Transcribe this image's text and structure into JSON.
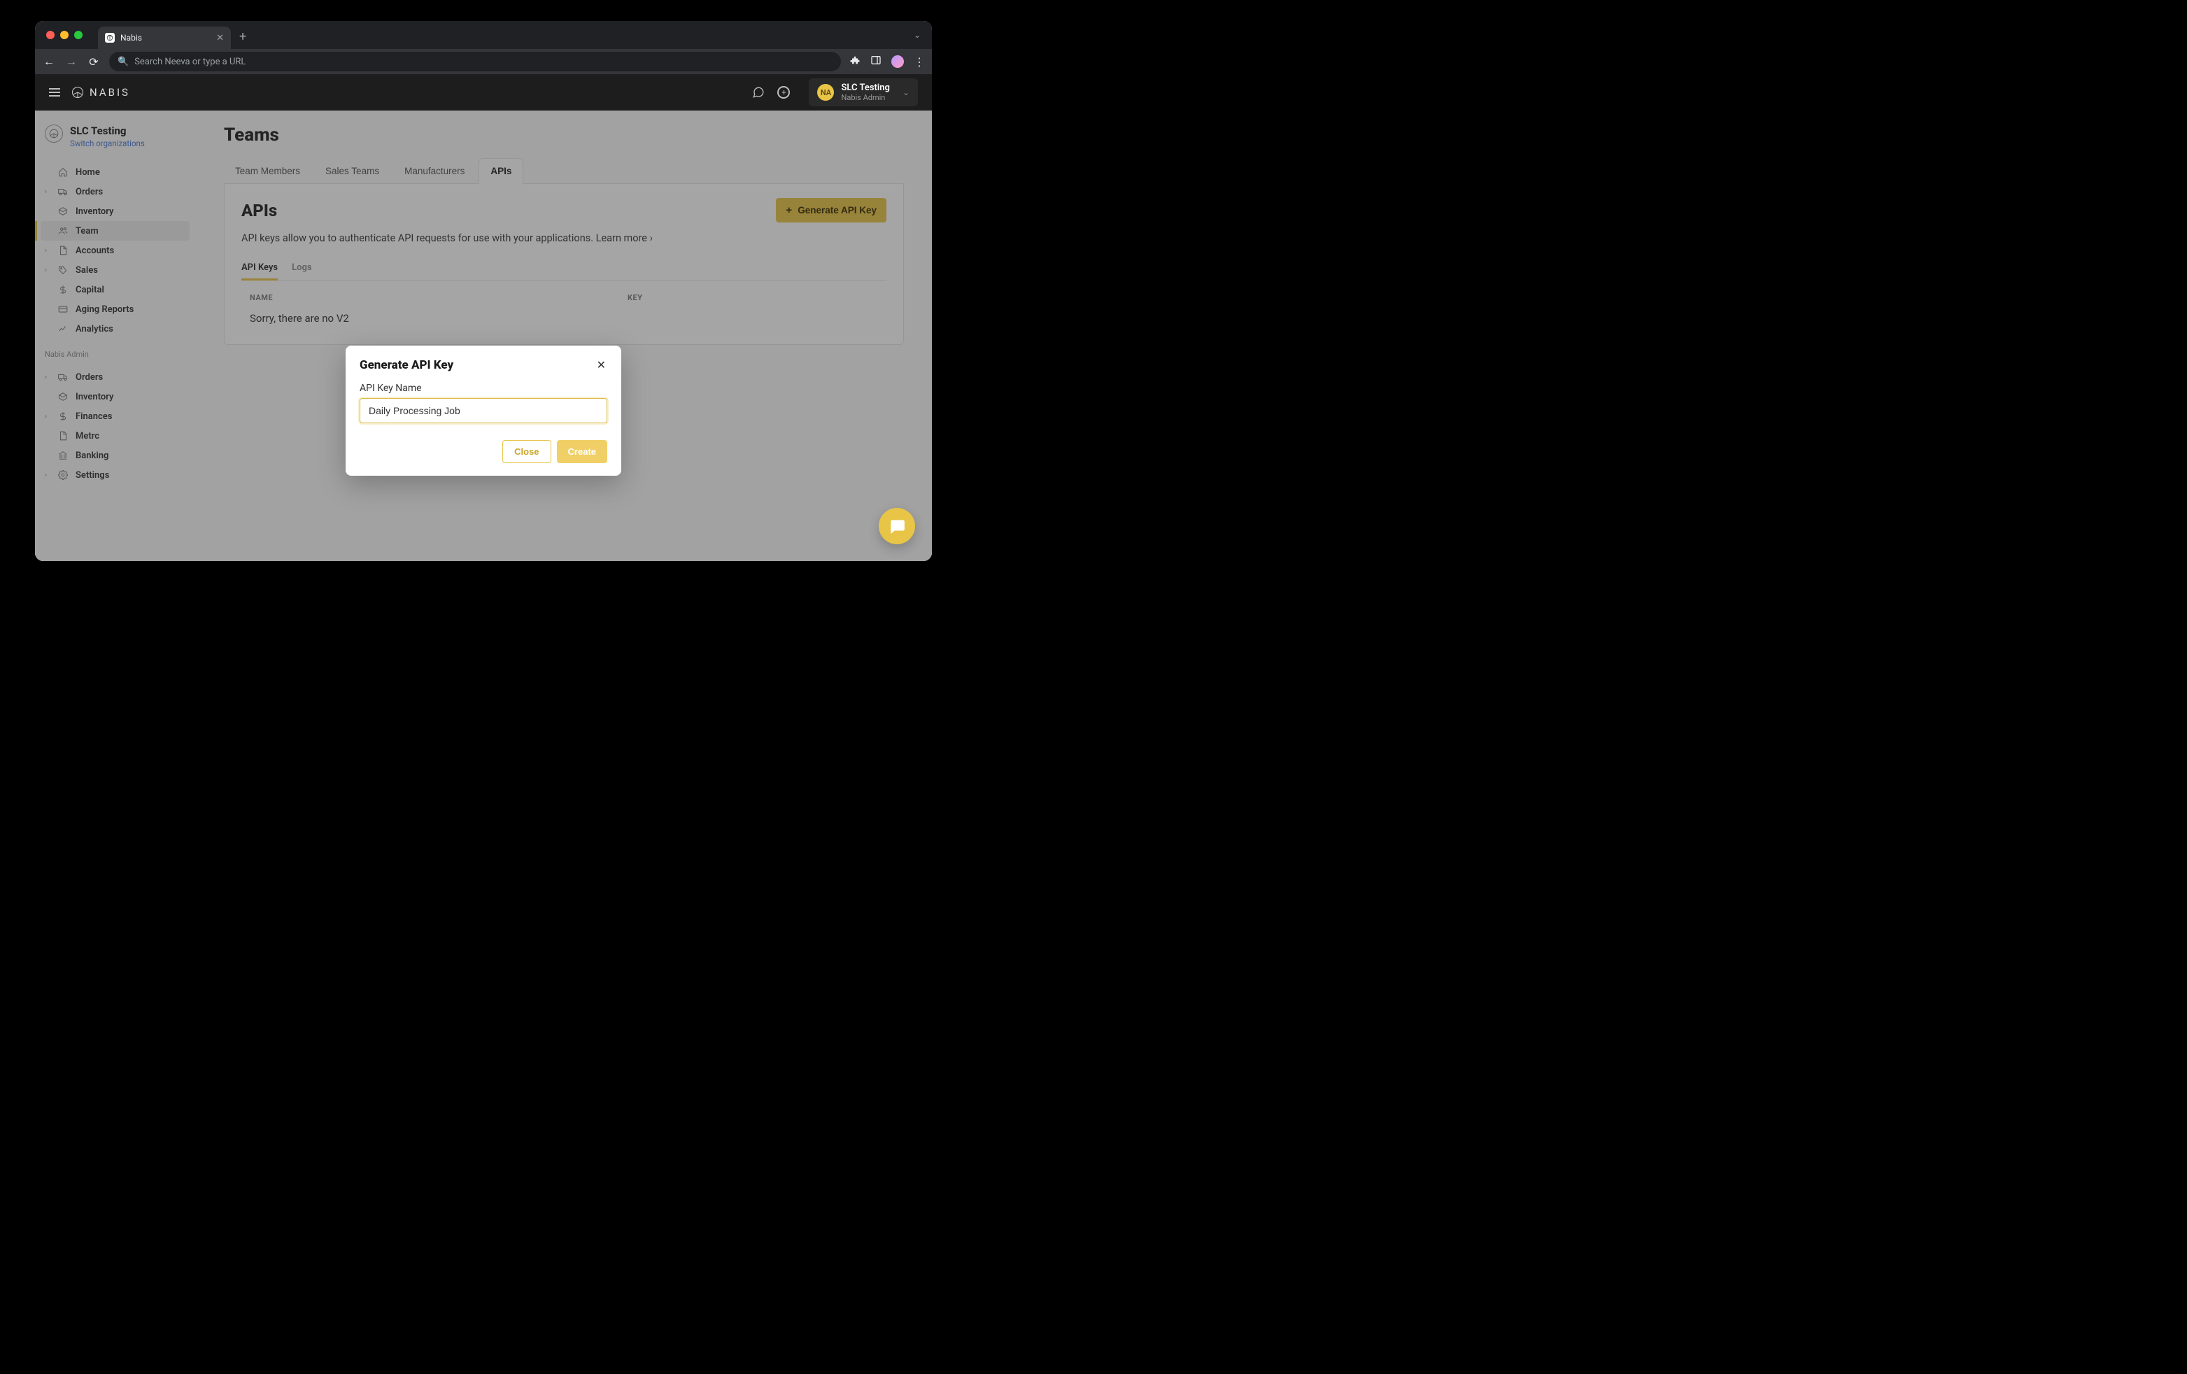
{
  "browser": {
    "tab_title": "Nabis",
    "omnibox_placeholder": "Search Neeva or type a URL"
  },
  "header": {
    "app_name": "NABIS",
    "avatar_initials": "NA",
    "user_name": "SLC Testing",
    "user_role": "Nabis Admin"
  },
  "sidebar": {
    "org_name": "SLC Testing",
    "switch_label": "Switch organizations",
    "section1": [
      {
        "label": "Home",
        "icon": "home",
        "caret": false
      },
      {
        "label": "Orders",
        "icon": "truck",
        "caret": true
      },
      {
        "label": "Inventory",
        "icon": "box",
        "caret": false
      },
      {
        "label": "Team",
        "icon": "users",
        "caret": false,
        "active": true
      },
      {
        "label": "Accounts",
        "icon": "document",
        "caret": true
      },
      {
        "label": "Sales",
        "icon": "tag",
        "caret": true
      },
      {
        "label": "Capital",
        "icon": "dollar",
        "caret": false
      },
      {
        "label": "Aging Reports",
        "icon": "card",
        "caret": false
      },
      {
        "label": "Analytics",
        "icon": "chart",
        "caret": false
      }
    ],
    "section2_title": "Nabis Admin",
    "section2": [
      {
        "label": "Orders",
        "icon": "truck",
        "caret": true
      },
      {
        "label": "Inventory",
        "icon": "box",
        "caret": false
      },
      {
        "label": "Finances",
        "icon": "dollar",
        "caret": true
      },
      {
        "label": "Metrc",
        "icon": "document",
        "caret": false
      },
      {
        "label": "Banking",
        "icon": "bank",
        "caret": false
      },
      {
        "label": "Settings",
        "icon": "gear",
        "caret": true
      }
    ]
  },
  "main": {
    "page_title": "Teams",
    "tabs": [
      "Team Members",
      "Sales Teams",
      "Manufacturers",
      "APIs"
    ],
    "active_tab": "APIs",
    "panel_title": "APIs",
    "generate_button": "Generate API Key",
    "description": "API keys allow you to authenticate API requests for use with your applications.",
    "learn_more": "Learn more",
    "subtabs": [
      "API Keys",
      "Logs"
    ],
    "active_subtab": "API Keys",
    "columns": {
      "name": "NAME",
      "key": "KEY"
    },
    "empty_message": "Sorry, there are no V2"
  },
  "modal": {
    "title": "Generate API Key",
    "field_label": "API Key Name",
    "input_value": "Daily Processing Job",
    "close_label": "Close",
    "create_label": "Create"
  }
}
